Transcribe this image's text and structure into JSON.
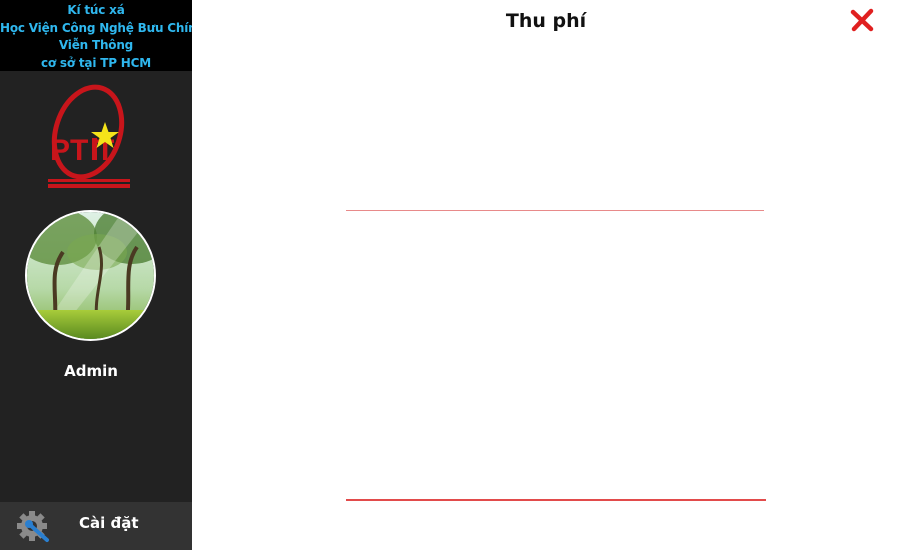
{
  "sidebar": {
    "brand_lines": [
      "Kí túc xá",
      "Học Viện Công Nghệ Bưu Chính",
      "Viễn Thông",
      "cơ sở tại TP HCM"
    ],
    "brand_color": "#2fb7ee",
    "logo_text": "PTIT",
    "user_name": "Admin",
    "settings_label": "Cài đặt"
  },
  "main": {
    "title": "Thu phí"
  },
  "icons": {
    "close": "close-icon",
    "settings": "gear-wrench-icon"
  },
  "colors": {
    "sidebar_bg": "#222222",
    "brand_bg": "#000000",
    "accent_red": "#e02020"
  }
}
